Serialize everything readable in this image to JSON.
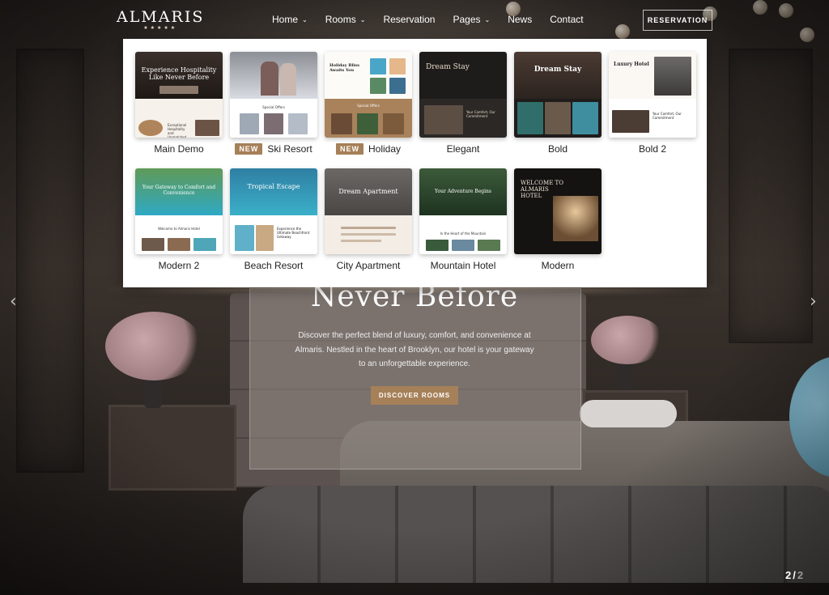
{
  "brand": {
    "name": "ALMARIS",
    "stars": "★★★★★"
  },
  "nav": {
    "items": [
      {
        "label": "Home",
        "caret": "⌄"
      },
      {
        "label": "Rooms",
        "caret": "⌄"
      },
      {
        "label": "Reservation",
        "caret": ""
      },
      {
        "label": "Pages",
        "caret": "⌄"
      },
      {
        "label": "News",
        "caret": ""
      },
      {
        "label": "Contact",
        "caret": ""
      }
    ],
    "reservation_button": "RESERVATION"
  },
  "mega_menu": {
    "new_badge": "NEW",
    "demos": [
      {
        "label": "Main Demo",
        "is_new": false,
        "caption": "Experience Hospitality Like Never Before",
        "sub": "Exceptional Hospitality and Unmatched Relaxation at"
      },
      {
        "label": "Ski Resort",
        "is_new": true,
        "caption": "",
        "sub": "Special Offers"
      },
      {
        "label": "Holiday",
        "is_new": true,
        "caption": "Holiday Bliss Awaits You",
        "sub": "Special Offers"
      },
      {
        "label": "Elegant",
        "is_new": false,
        "caption": "Dream Stay",
        "sub": "Your Comfort, Our Commitment"
      },
      {
        "label": "Bold",
        "is_new": false,
        "caption": "Dream Stay",
        "sub": ""
      },
      {
        "label": "Bold 2",
        "is_new": false,
        "caption": "Luxury Hotel",
        "sub": "Your Comfort, Our Commitment"
      },
      {
        "label": "Modern 2",
        "is_new": false,
        "caption": "Your Gateway to Comfort and Convenience",
        "sub": "Welcome to Almaris Hotel"
      },
      {
        "label": "Beach Resort",
        "is_new": false,
        "caption": "Tropical Escape",
        "sub": "Experience the Ultimate Beachfront Getaway"
      },
      {
        "label": "City Apartment",
        "is_new": false,
        "caption": "Dream Apartment",
        "sub": ""
      },
      {
        "label": "Mountain Hotel",
        "is_new": false,
        "caption": "Your Adventure Begins",
        "sub": "In the Heart of the Mountain"
      },
      {
        "label": "Modern",
        "is_new": false,
        "caption": "WELCOME TO ALMARIS HOTEL",
        "sub": ""
      }
    ]
  },
  "hero": {
    "title": "Never Before",
    "description": "Discover the perfect blend of luxury, comfort, and convenience at Almaris. Nestled in the heart of Brooklyn, our hotel is your gateway to an unforgettable experience.",
    "button": "DISCOVER ROOMS"
  },
  "slider": {
    "prev": "‹",
    "next": "›",
    "current": "2",
    "separator": "/",
    "total": "2"
  },
  "colors": {
    "accent": "#a68058",
    "menu_bg": "#ffffff"
  }
}
